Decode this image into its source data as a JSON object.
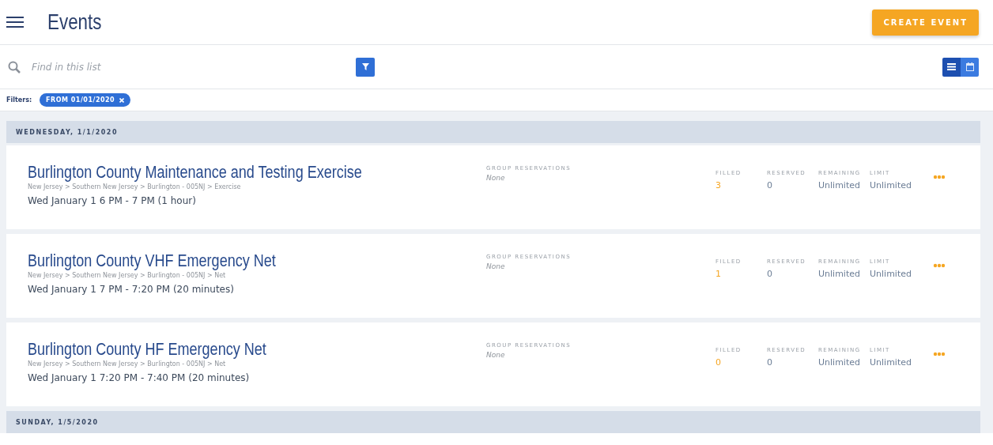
{
  "header": {
    "title": "Events",
    "create_button": "CREATE EVENT"
  },
  "search": {
    "placeholder": "Find in this list"
  },
  "view_toggle": [
    {
      "kind": "list",
      "selected": true
    },
    {
      "kind": "calendar",
      "selected": false
    }
  ],
  "filters": {
    "label": "Filters:",
    "chips": [
      {
        "label": "FROM 01/01/2020"
      }
    ]
  },
  "groups": [
    {
      "date": "WEDNESDAY, 1/1/2020",
      "events": [
        {
          "title": "Burlington County Maintenance and Testing Exercise",
          "path": "New Jersey > Southern New Jersey > Burlington - 005NJ > Exercise",
          "time": "Wed January 1 6 PM - 7 PM (1 hour)",
          "group_label": "GROUP RESERVATIONS",
          "group_value": "None",
          "filled_label": "FILLED",
          "filled": "3",
          "reserved_label": "RESERVED",
          "reserved": "0",
          "remaining_label": "REMAINING",
          "remaining": "Unlimited",
          "limit_label": "LIMIT",
          "limit": "Unlimited"
        },
        {
          "title": "Burlington County VHF Emergency Net",
          "path": "New Jersey > Southern New Jersey > Burlington - 005NJ > Net",
          "time": "Wed January 1 7 PM - 7:20 PM (20 minutes)",
          "group_label": "GROUP RESERVATIONS",
          "group_value": "None",
          "filled_label": "FILLED",
          "filled": "1",
          "reserved_label": "RESERVED",
          "reserved": "0",
          "remaining_label": "REMAINING",
          "remaining": "Unlimited",
          "limit_label": "LIMIT",
          "limit": "Unlimited"
        },
        {
          "title": "Burlington County HF Emergency Net",
          "path": "New Jersey > Southern New Jersey > Burlington - 005NJ > Net",
          "time": "Wed January 1 7:20 PM - 7:40 PM (20 minutes)",
          "group_label": "GROUP RESERVATIONS",
          "group_value": "None",
          "filled_label": "FILLED",
          "filled": "0",
          "reserved_label": "RESERVED",
          "reserved": "0",
          "remaining_label": "REMAINING",
          "remaining": "Unlimited",
          "limit_label": "LIMIT",
          "limit": "Unlimited"
        }
      ]
    },
    {
      "date": "SUNDAY, 1/5/2020"
    }
  ]
}
